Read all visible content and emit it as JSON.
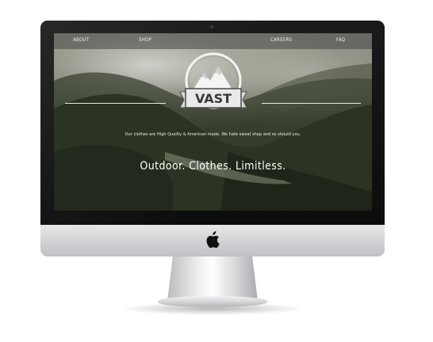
{
  "nav": {
    "items": [
      {
        "label": "ABOUT"
      },
      {
        "label": "SHOP"
      },
      {
        "label": "CAREERS"
      },
      {
        "label": "FAQ"
      }
    ]
  },
  "hero": {
    "brand": "VAST",
    "tagline": "Our clothes are High Quality & American made. We hate sweat shop and so should you.",
    "headline": "Outdoor. Clothes. Limitless."
  },
  "icons": {
    "logo": "mountain-badge-icon",
    "apple": "apple-logo-icon",
    "camera": "webcam-icon"
  },
  "colors": {
    "bezel": "#0f0f0f",
    "aluminum": "#d3d5d8",
    "nav_bar": "#464646",
    "text": "#ffffff"
  }
}
